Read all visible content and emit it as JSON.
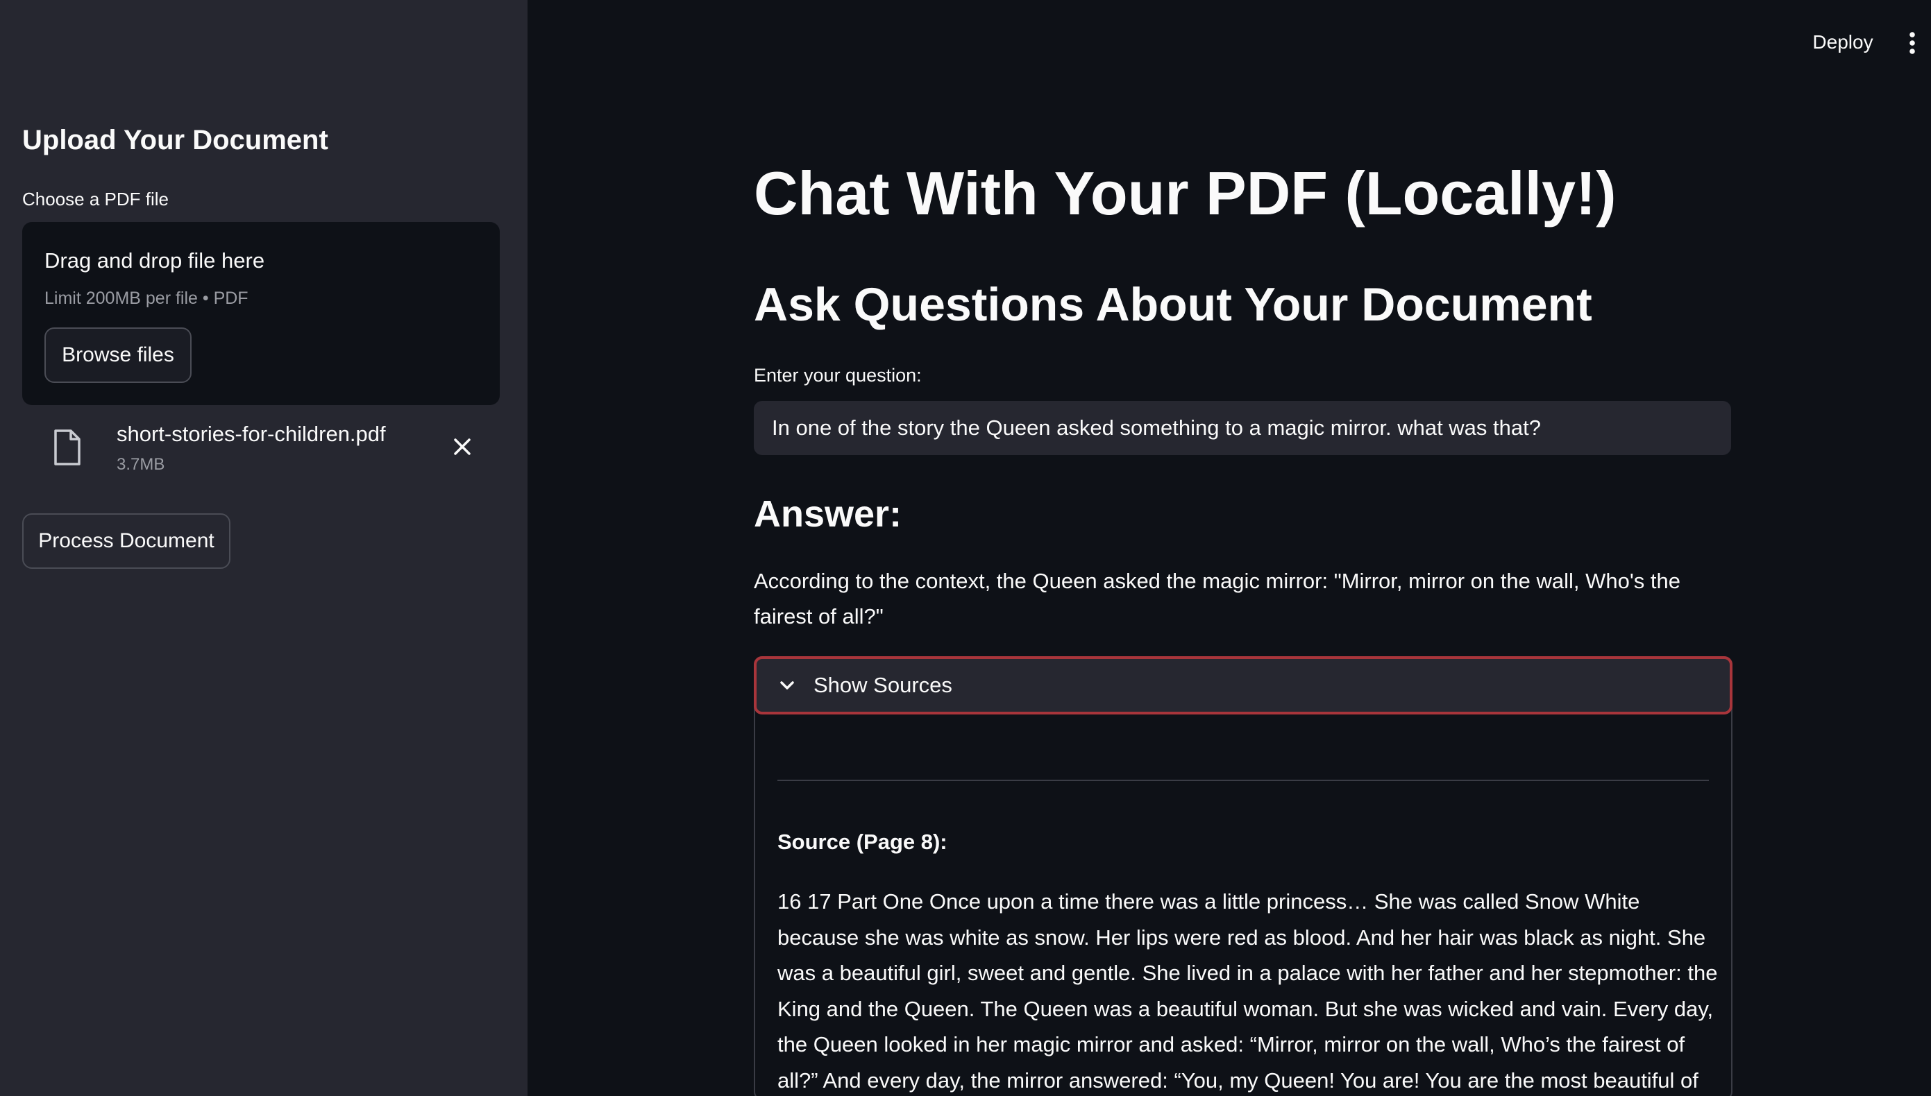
{
  "header": {
    "deploy_label": "Deploy",
    "menu_icon": "more-vertical-icon"
  },
  "sidebar": {
    "title": "Upload Your Document",
    "uploader_label": "Choose a PDF file",
    "dropzone": {
      "title": "Drag and drop file here",
      "limit": "Limit 200MB per file • PDF",
      "browse_label": "Browse files"
    },
    "file": {
      "name": "short-stories-for-children.pdf",
      "size": "3.7MB",
      "icon": "file-icon",
      "remove_icon": "close-icon"
    },
    "process_label": "Process Document"
  },
  "main": {
    "title": "Chat With Your PDF (Locally!)",
    "subtitle": "Ask Questions About Your Document",
    "question_label": "Enter your question:",
    "question_value": "In one of the story the Queen asked something to a magic mirror. what was that?",
    "answer_heading": "Answer:",
    "answer_text": "According to the context, the Queen asked the magic mirror: \"Mirror, mirror on the wall, Who's the fairest of all?\"",
    "sources": {
      "toggle_label": "Show Sources",
      "toggle_icon": "chevron-down-icon",
      "source_title": "Source (Page 8):",
      "source_text": "16 17 Part One Once upon a time there was a little princess… She was called Snow White because she was white as snow. Her lips were red as blood. And her hair was black as night. She was a beautiful girl, sweet and gentle. She lived in a palace with her father and her stepmother: the King and the Queen. The Queen was a beautiful woman. But she was wicked and vain. Every day, the Queen looked in her magic mirror and asked: “Mirror, mirror on the wall, Who’s the fairest of all?” And every day, the mirror answered: “You, my Queen! You are! You are the most beautiful of all.”"
    }
  },
  "colors": {
    "background": "#0e1117",
    "sidebar": "#262730",
    "focus_border": "#a8353b"
  }
}
